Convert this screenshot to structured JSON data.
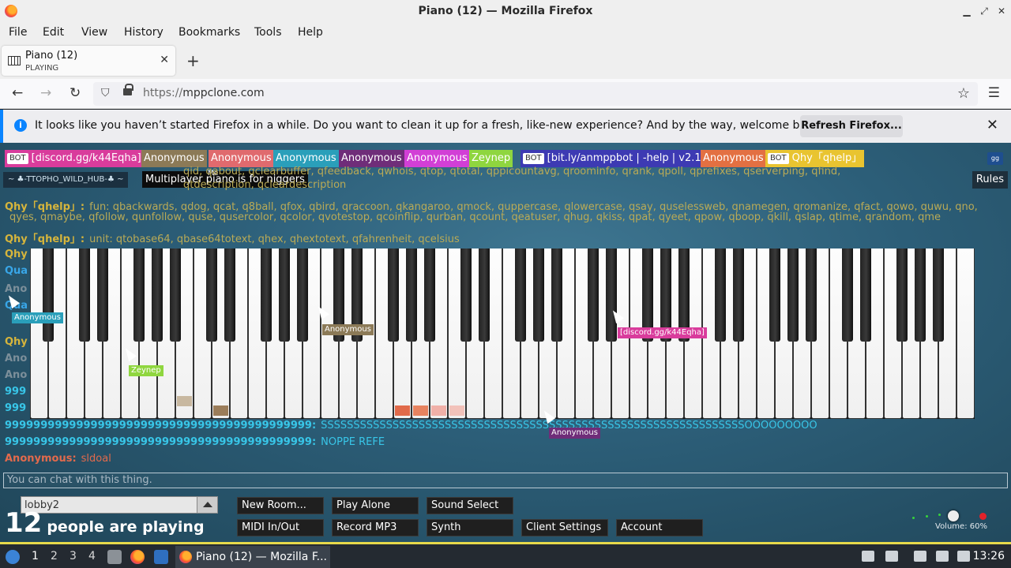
{
  "window": {
    "title": "Piano (12) — Mozilla Firefox"
  },
  "menu": [
    "File",
    "Edit",
    "View",
    "History",
    "Bookmarks",
    "Tools",
    "Help"
  ],
  "tab": {
    "title": "Piano (12)",
    "subtitle": "PLAYING"
  },
  "url": {
    "protocol": "https://",
    "host": "mppclone.com"
  },
  "notification": {
    "message": "It looks like you haven’t started Firefox in a while. Do you want to clean it up for a fresh, like-new experience? And by the way, welcome back!",
    "button": "Refresh Firefox..."
  },
  "players": [
    {
      "name": "[discord.gg/k44Eqha]",
      "bot": true,
      "color": "#d93c9c"
    },
    {
      "name": "Anonymous",
      "bot": false,
      "color": "#8c7a57"
    },
    {
      "name": "Anonymous",
      "bot": false,
      "color": "#e06a6e"
    },
    {
      "name": "Anonymous",
      "bot": false,
      "color": "#2a9fba"
    },
    {
      "name": "Anonymous",
      "bot": false,
      "color": "#6f2d79"
    },
    {
      "name": "Anonymous",
      "bot": false,
      "color": "#d23fd6"
    },
    {
      "name": "Zeynep",
      "bot": false,
      "color": "#8fd63f"
    },
    {
      "name": "[bit.ly/anmppbot | -help | v2.1]",
      "bot": true,
      "color": "#3d3ab3"
    },
    {
      "name": "Anonymous",
      "bot": false,
      "color": "#e37042"
    },
    {
      "name": "Qhy「qhelp」",
      "bot": true,
      "color": "#e9c430"
    }
  ],
  "bot_label": "BOT",
  "room_tag": "~ ♣-TTOPHO_WILD_HUB-♣ ~",
  "tooltip": {
    "text": "Multiplayer piano is for niggers",
    "me": "Me"
  },
  "rules_label": "Rules",
  "gg_label": "gg",
  "chat": [
    {
      "name": "",
      "text": "qid, qabout, qclearbuffer, qfeedback, qwhois, qtop, qtotal, qppicountavg, qroominfo, qrank, qpoll, qprefixes, qserverping, qfind,",
      "text_color": "#b9aa56"
    },
    {
      "name": "",
      "text": "qtdescription, qcleardescription",
      "text_color": "#b9aa56"
    },
    {
      "name": "Qhy「qhelp」:",
      "text": "fun: qbackwards, qdog, qcat, q8ball, qfox, qbird, qraccoon, qkangaroo, qmock, quppercase, qlowercase, qsay, quselessweb, qnamegen, qromanize, qfact, qowo, quwu, qno,",
      "name_color": "#d6b53c",
      "text_color": "#b9aa56"
    },
    {
      "name": "",
      "text": "qyes, qmaybe, qfollow, qunfollow, quse, qusercolor, qcolor, qvotestop, qcoinflip, qurban, qcount, qeatuser, qhug, qkiss, qpat, qyeet, qpow, qboop, qkill, qslap, qtime, qrandom, qme",
      "text_color": "#b9aa56"
    },
    {
      "name": "Qhy「qhelp」:",
      "text": "unit: qtobase64, qbase64totext, qhex, qhextotext, qfahrenheit, qcelsius",
      "name_color": "#d6b53c",
      "text_color": "#b9aa56"
    },
    {
      "name": "9999999999999999999999999999999999999999999:",
      "text": "SSSSSSSSSSSSSSSSSSSSSSSSSSSSSSSSSSSSSSSSSSSSSSSSSSSSSSSSSSSSSSSSSOOOOOOOOO",
      "name_color": "#38c6e8",
      "text_color": "#38c6e8"
    },
    {
      "name": "9999999999999999999999999999999999999999999:",
      "text": "NOPPE REFE",
      "name_color": "#38c6e8",
      "text_color": "#38c6e8"
    },
    {
      "name": "Anonymous:",
      "text": "sldoal",
      "name_color": "#e36a4c",
      "text_color": "#e36a4c"
    }
  ],
  "left_fragments": [
    "Qhy",
    "Qua",
    "Ano",
    "Qua",
    "Qhy",
    "Ano",
    "Ano",
    "999",
    "999"
  ],
  "cursors": [
    {
      "name": "Anonymous",
      "color": "#2a9fba"
    },
    {
      "name": "Anonymous",
      "color": "#8c7a57"
    },
    {
      "name": "[discord.gg/k44Eqha]",
      "color": "#d93c9c"
    },
    {
      "name": "Zeynep",
      "color": "#8fd63f"
    },
    {
      "name": "Anonymous",
      "color": "#6f2d79"
    }
  ],
  "chat_placeholder": "You can chat with this thing.",
  "room": "lobby2",
  "people": {
    "count": "12",
    "label": "people are playing"
  },
  "buttons": [
    "New Room...",
    "Play Alone",
    "Sound Select",
    "MIDI In/Out",
    "Record MP3",
    "Synth",
    "Client Settings",
    "Account"
  ],
  "volume": {
    "label": "Volume: 60%",
    "value": 0.6
  },
  "taskbar": {
    "workspaces": [
      "1",
      "2",
      "3",
      "4"
    ],
    "task": "Piano (12) — Mozilla F...",
    "clock": "13:26"
  }
}
